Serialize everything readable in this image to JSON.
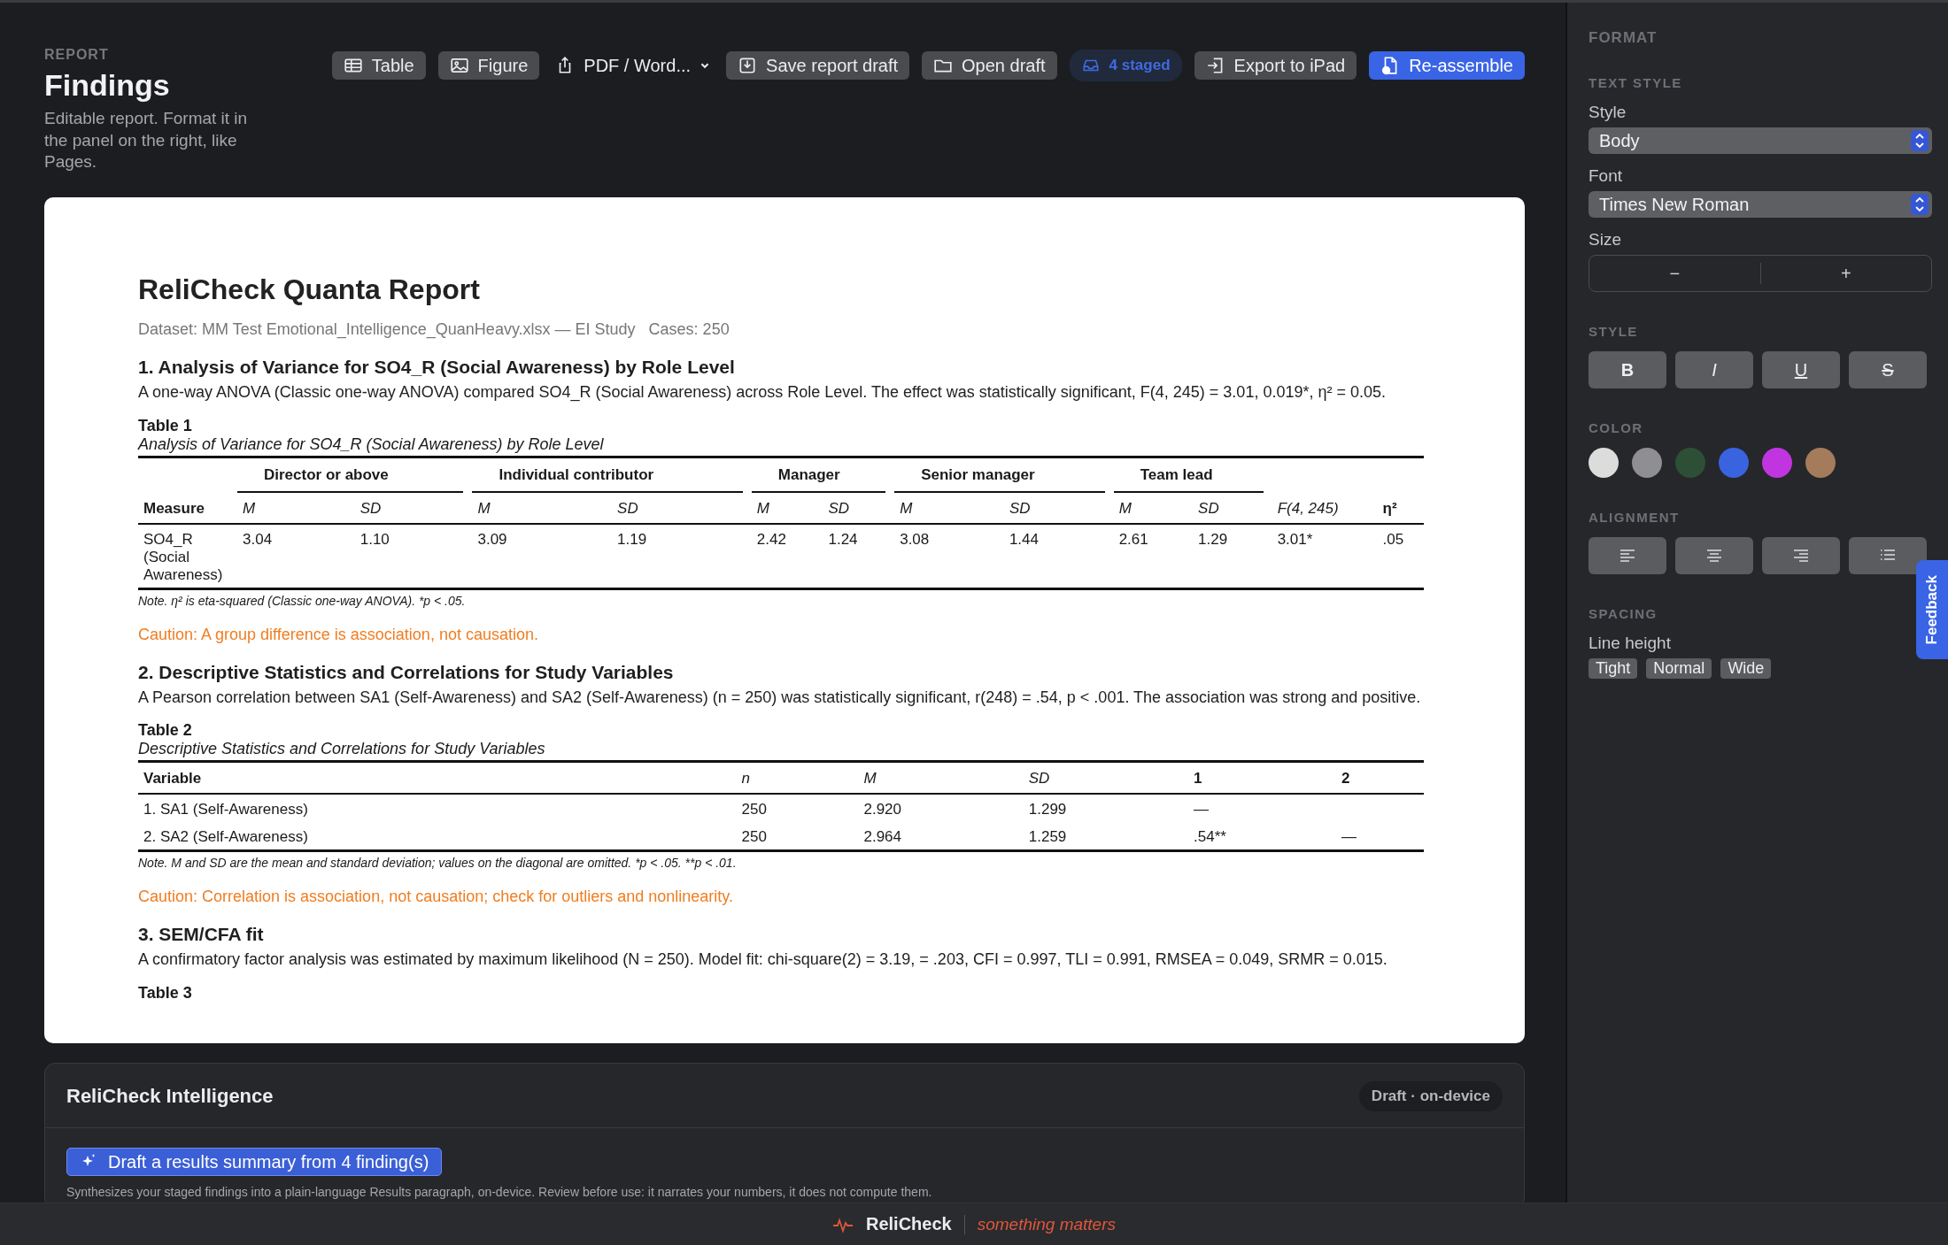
{
  "header": {
    "eyebrow": "REPORT",
    "title": "Findings",
    "description": "Editable report. Format it in the panel on the right, like Pages."
  },
  "toolbar": [
    {
      "label": "Table",
      "kind": "button"
    },
    {
      "label": "Figure",
      "kind": "button"
    },
    {
      "label": "PDF / Word...",
      "kind": "menu"
    },
    {
      "label": "Save report draft",
      "kind": "button"
    },
    {
      "label": "Open draft",
      "kind": "button"
    },
    {
      "label": "4 staged",
      "kind": "badge"
    },
    {
      "label": "Export to iPad",
      "kind": "button"
    },
    {
      "label": "Re-assemble",
      "kind": "primary"
    }
  ],
  "report": {
    "title": "ReliCheck Quanta Report",
    "dataset": "Dataset: MM Test Emotional_Intelligence_QuanHeavy.xlsx — EI Study   Cases: 250",
    "sections": [
      {
        "heading": "1. Analysis of Variance for SO4_R (Social Awareness) by Role Level",
        "paragraph": "A one-way ANOVA (Classic one-way ANOVA) compared SO4_R (Social Awareness) across Role Level. The effect was statistically significant, F(4, 245) = 3.01, 0.019*, η² = 0.05.",
        "table": {
          "label": "Table 1",
          "caption": "Analysis of Variance for SO4_R (Social Awareness) by Role Level",
          "groups": [
            "Director or above",
            "Individual contributor",
            "Manager",
            "Senior manager",
            "Team lead"
          ],
          "columns": [
            "Measure",
            "M",
            "SD",
            "M",
            "SD",
            "M",
            "SD",
            "M",
            "SD",
            "M",
            "SD",
            "F(4, 245)",
            "η²"
          ],
          "rows": [
            [
              "SO4_R (Social Awareness)",
              "3.04",
              "1.10",
              "3.09",
              "1.19",
              "2.42",
              "1.24",
              "3.08",
              "1.44",
              "2.61",
              "1.29",
              "3.01*",
              ".05"
            ]
          ],
          "note": "Note. η² is eta-squared (Classic one-way ANOVA). *p < .05."
        },
        "caution": "Caution: A group difference is association, not causation."
      },
      {
        "heading": "2. Descriptive Statistics and Correlations for Study Variables",
        "paragraph": "A Pearson correlation between SA1 (Self-Awareness) and SA2 (Self-Awareness) (n = 250) was statistically significant, r(248) = .54, p < .001. The association was strong and positive.",
        "table": {
          "label": "Table 2",
          "caption": "Descriptive Statistics and Correlations for Study Variables",
          "columns": [
            "Variable",
            "n",
            "M",
            "SD",
            "1",
            "2"
          ],
          "rows": [
            [
              "1. SA1 (Self-Awareness)",
              "250",
              "2.920",
              "1.299",
              "—",
              ""
            ],
            [
              "2. SA2 (Self-Awareness)",
              "250",
              "2.964",
              "1.259",
              ".54**",
              "—"
            ]
          ],
          "note": "Note. M and SD are the mean and standard deviation; values on the diagonal are omitted. *p < .05. **p < .01."
        },
        "caution": "Caution: Correlation is association, not causation; check for outliers and nonlinearity."
      },
      {
        "heading": "3. SEM/CFA fit",
        "paragraph": "A confirmatory factor analysis was estimated by maximum likelihood (N = 250). Model fit: chi-square(2) = 3.19, = .203, CFI = 0.997, TLI = 0.991, RMSEA = 0.049, SRMR = 0.015.",
        "table": {
          "label": "Table 3"
        }
      }
    ]
  },
  "intelligence": {
    "title": "ReliCheck Intelligence",
    "badge": "Draft · on-device",
    "button": "Draft a results summary from 4 finding(s)",
    "description": "Synthesizes your staged findings into a plain-language Results paragraph, on-device. Review before use: it narrates your numbers, it does not compute them."
  },
  "format_panel": {
    "title": "FORMAT",
    "text_style": {
      "heading": "TEXT STYLE",
      "style_label": "Style",
      "style_value": "Body",
      "font_label": "Font",
      "font_value": "Times New Roman",
      "size_label": "Size",
      "size_buttons": [
        "−",
        "+"
      ]
    },
    "style": {
      "heading": "STYLE",
      "buttons": [
        "B",
        "I",
        "U",
        "S"
      ]
    },
    "color": {
      "heading": "COLOR",
      "swatches": [
        {
          "color": "#dcdcdc"
        },
        {
          "color": "#8e8e93"
        },
        {
          "color": "#2d4f36"
        },
        {
          "color": "#3a63e0"
        },
        {
          "color": "#c035e0"
        },
        {
          "color": "#a47c5c"
        }
      ]
    },
    "alignment": {
      "heading": "ALIGNMENT"
    },
    "spacing": {
      "heading": "SPACING",
      "line_height_label": "Line height",
      "options": [
        "Tight",
        "Normal",
        "Wide"
      ]
    }
  },
  "feedback": "Feedback",
  "footer": {
    "brand": "ReliCheck",
    "tagline": "something matters"
  }
}
